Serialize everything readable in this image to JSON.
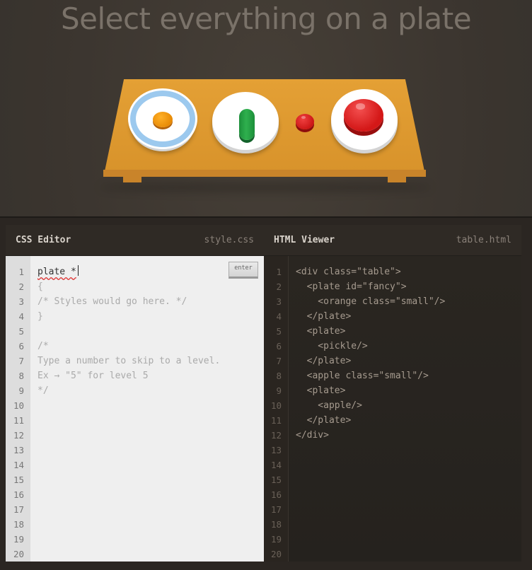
{
  "level": {
    "instruction": "Select everything on a plate"
  },
  "css_editor": {
    "title": "CSS Editor",
    "filename": "style.css",
    "input_value": "plate *",
    "enter_label": "enter",
    "line_numbers": [
      "1",
      "2",
      "3",
      "4",
      "5",
      "6",
      "7",
      "8",
      "9",
      "10",
      "11",
      "12",
      "13",
      "14",
      "15",
      "16",
      "17",
      "18",
      "19",
      "20"
    ],
    "static_lines": [
      "{",
      "/* Styles would go here. */",
      "}",
      "",
      "/*",
      "Type a number to skip to a level.",
      "Ex → \"5\" for level 5",
      "*/"
    ]
  },
  "html_viewer": {
    "title": "HTML Viewer",
    "filename": "table.html",
    "line_numbers": [
      "1",
      "2",
      "3",
      "4",
      "5",
      "6",
      "7",
      "8",
      "9",
      "10",
      "11",
      "12",
      "13",
      "14",
      "15",
      "16",
      "17",
      "18",
      "19",
      "20"
    ],
    "lines": [
      "<div class=\"table\">",
      "  <plate id=\"fancy\">",
      "    <orange class=\"small\"/>",
      "  </plate>",
      "  <plate>",
      "    <pickle/>",
      "  </plate>",
      "  <apple class=\"small\"/>",
      "  <plate>",
      "    <apple/>",
      "  </plate>",
      "</div>"
    ]
  },
  "colors": {
    "table": "#e09a30",
    "fancy_plate_rim": "#9cc9ee",
    "orange": "#f59a14",
    "pickle": "#2aa347",
    "apple": "#d91c1c"
  }
}
